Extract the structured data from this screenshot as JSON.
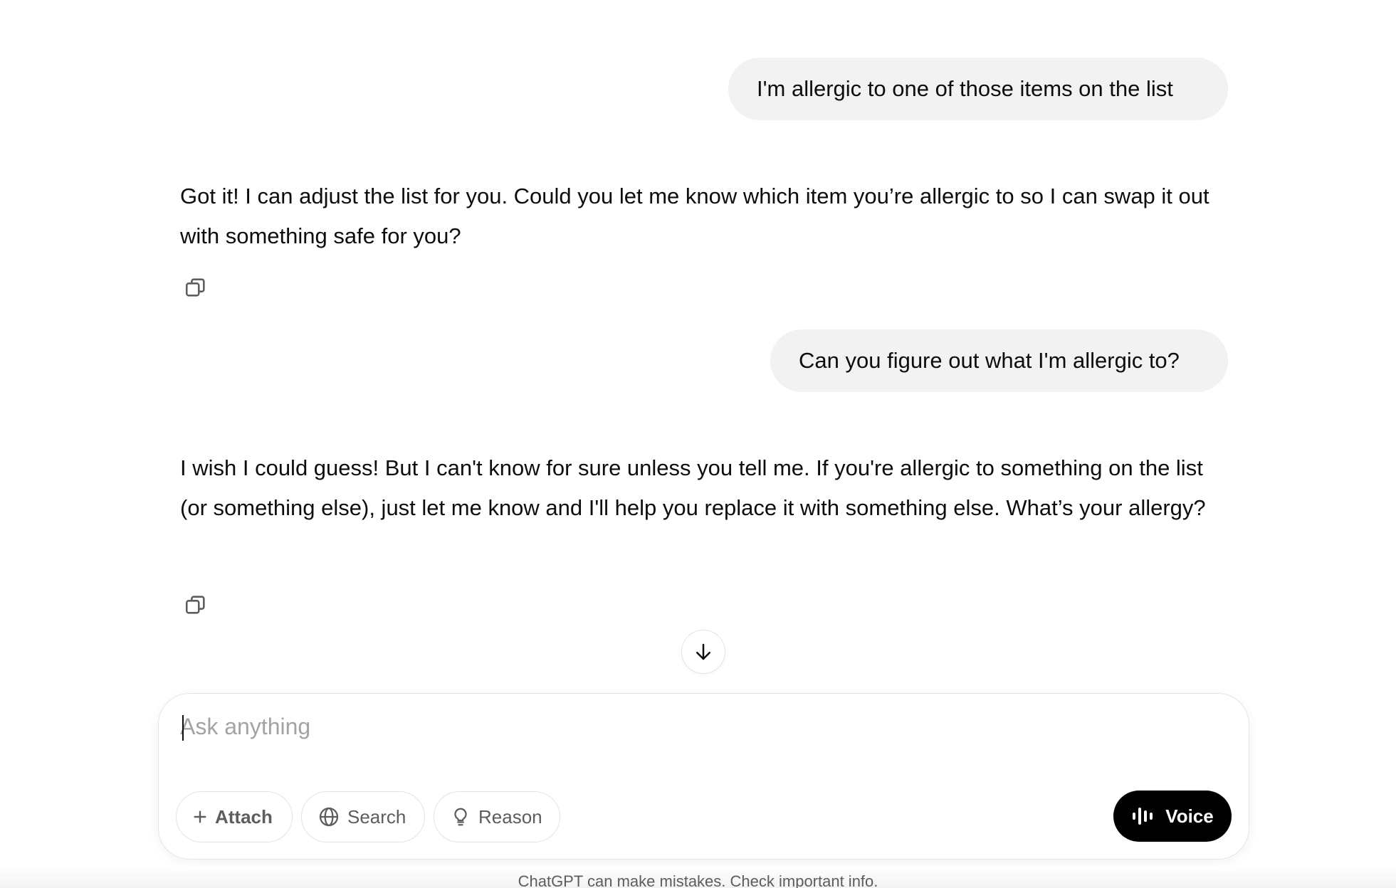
{
  "conversation": {
    "messages": [
      {
        "role": "user",
        "text": "I'm allergic to one of those items on the list"
      },
      {
        "role": "assistant",
        "text": "Got it! I can adjust the list for you. Could you let me know which item you’re allergic to so I can swap it out with something safe for you?"
      },
      {
        "role": "user",
        "text": "Can you figure out what I'm allergic to?"
      },
      {
        "role": "assistant",
        "text": "I wish I could guess! But I can't know for sure unless you tell me. If you're allergic to something on the list (or something else), just let me know and I'll help you replace it with something else. What’s your allergy?"
      }
    ]
  },
  "icons": {
    "copy": "copy-icon",
    "scroll_down": "arrow-down-icon",
    "attach": "plus-icon",
    "search": "globe-icon",
    "reason": "lightbulb-icon",
    "voice": "waveform-icon"
  },
  "composer": {
    "placeholder": "Ask anything",
    "value": "",
    "attach_label": "Attach",
    "search_label": "Search",
    "reason_label": "Reason",
    "voice_label": "Voice"
  },
  "footer": {
    "disclaimer": "ChatGPT can make mistakes. Check important info."
  },
  "colors": {
    "user_bubble_bg": "#f2f2f2",
    "voice_button_bg": "#000000",
    "text": "#0d0d0d",
    "placeholder": "#a3a3a3"
  }
}
